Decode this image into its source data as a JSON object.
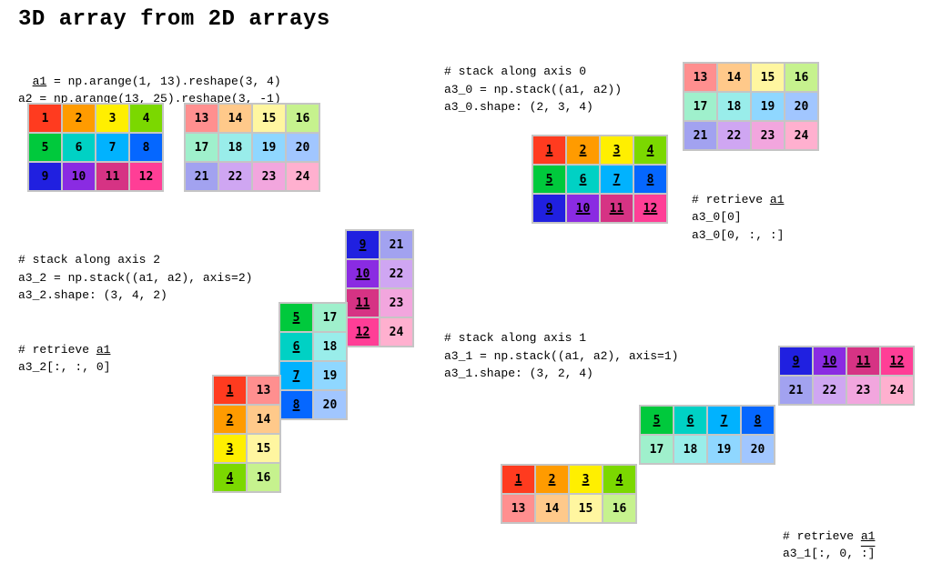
{
  "title": "3D array from 2D arrays",
  "code": {
    "defs": "a1 = np.arange(1, 13).reshape(3, 4)\na2 = np.arange(13, 25).reshape(3, -1)",
    "a1label": "a1",
    "stack0_code": "# stack along axis 0\na3_0 = np.stack((a1, a2))\na3_0.shape: (2, 3, 4)",
    "retrieve0": "# retrieve a1\na3_0[0]\na3_0[0, :, :]",
    "retrieve0_a1": "a1",
    "stack2_code": "# stack along axis 2\na3_2 = np.stack((a1, a2), axis=2)\na3_2.shape: (3, 4, 2)",
    "retrieve2": "# retrieve a1\na3_2[:, :, 0]",
    "retrieve2_a1": "a1",
    "stack1_code": "# stack along axis 1\na3_1 = np.stack((a1, a2), axis=1)\na3_1.shape: (3, 2, 4)",
    "retrieve1": "# retrieve a1\na3_1[:, 0, :]",
    "retrieve1_a1": "a1"
  },
  "palette": {
    "c1": "#ff3b1f",
    "c2": "#ff9b00",
    "c3": "#ffef00",
    "c4": "#7bd800",
    "c5": "#00c93c",
    "c6": "#00d1c4",
    "c7": "#01b2fe",
    "c8": "#0567ff",
    "c9": "#2020e0",
    "c10": "#8a2be2",
    "c11": "#d63384",
    "c12": "#ff3e96",
    "c13": "#ff8f8f",
    "c14": "#ffc98a",
    "c15": "#fff6a0",
    "c16": "#c6f28e",
    "c17": "#9ff0cc",
    "c18": "#99edea",
    "c19": "#8fd7ff",
    "c20": "#a1c6ff",
    "c21": "#a2a2f0",
    "c22": "#cfa6f2",
    "c23": "#f2a6de",
    "c24": "#ffb0cf"
  },
  "a1": [
    [
      1,
      2,
      3,
      4
    ],
    [
      5,
      6,
      7,
      8
    ],
    [
      9,
      10,
      11,
      12
    ]
  ],
  "a2": [
    [
      13,
      14,
      15,
      16
    ],
    [
      17,
      18,
      19,
      20
    ],
    [
      21,
      22,
      23,
      24
    ]
  ],
  "axis2": {
    "slab0": [
      [
        1,
        13
      ],
      [
        2,
        14
      ],
      [
        3,
        15
      ],
      [
        4,
        16
      ]
    ],
    "slab1": [
      [
        5,
        17
      ],
      [
        6,
        18
      ],
      [
        7,
        19
      ],
      [
        8,
        20
      ]
    ],
    "slab2": [
      [
        9,
        21
      ],
      [
        10,
        22
      ],
      [
        11,
        23
      ],
      [
        12,
        24
      ]
    ]
  },
  "axis1": {
    "slab0": [
      [
        1,
        2,
        3,
        4
      ],
      [
        13,
        14,
        15,
        16
      ]
    ],
    "slab1": [
      [
        5,
        6,
        7,
        8
      ],
      [
        17,
        18,
        19,
        20
      ]
    ],
    "slab2": [
      [
        9,
        10,
        11,
        12
      ],
      [
        21,
        22,
        23,
        24
      ]
    ]
  }
}
